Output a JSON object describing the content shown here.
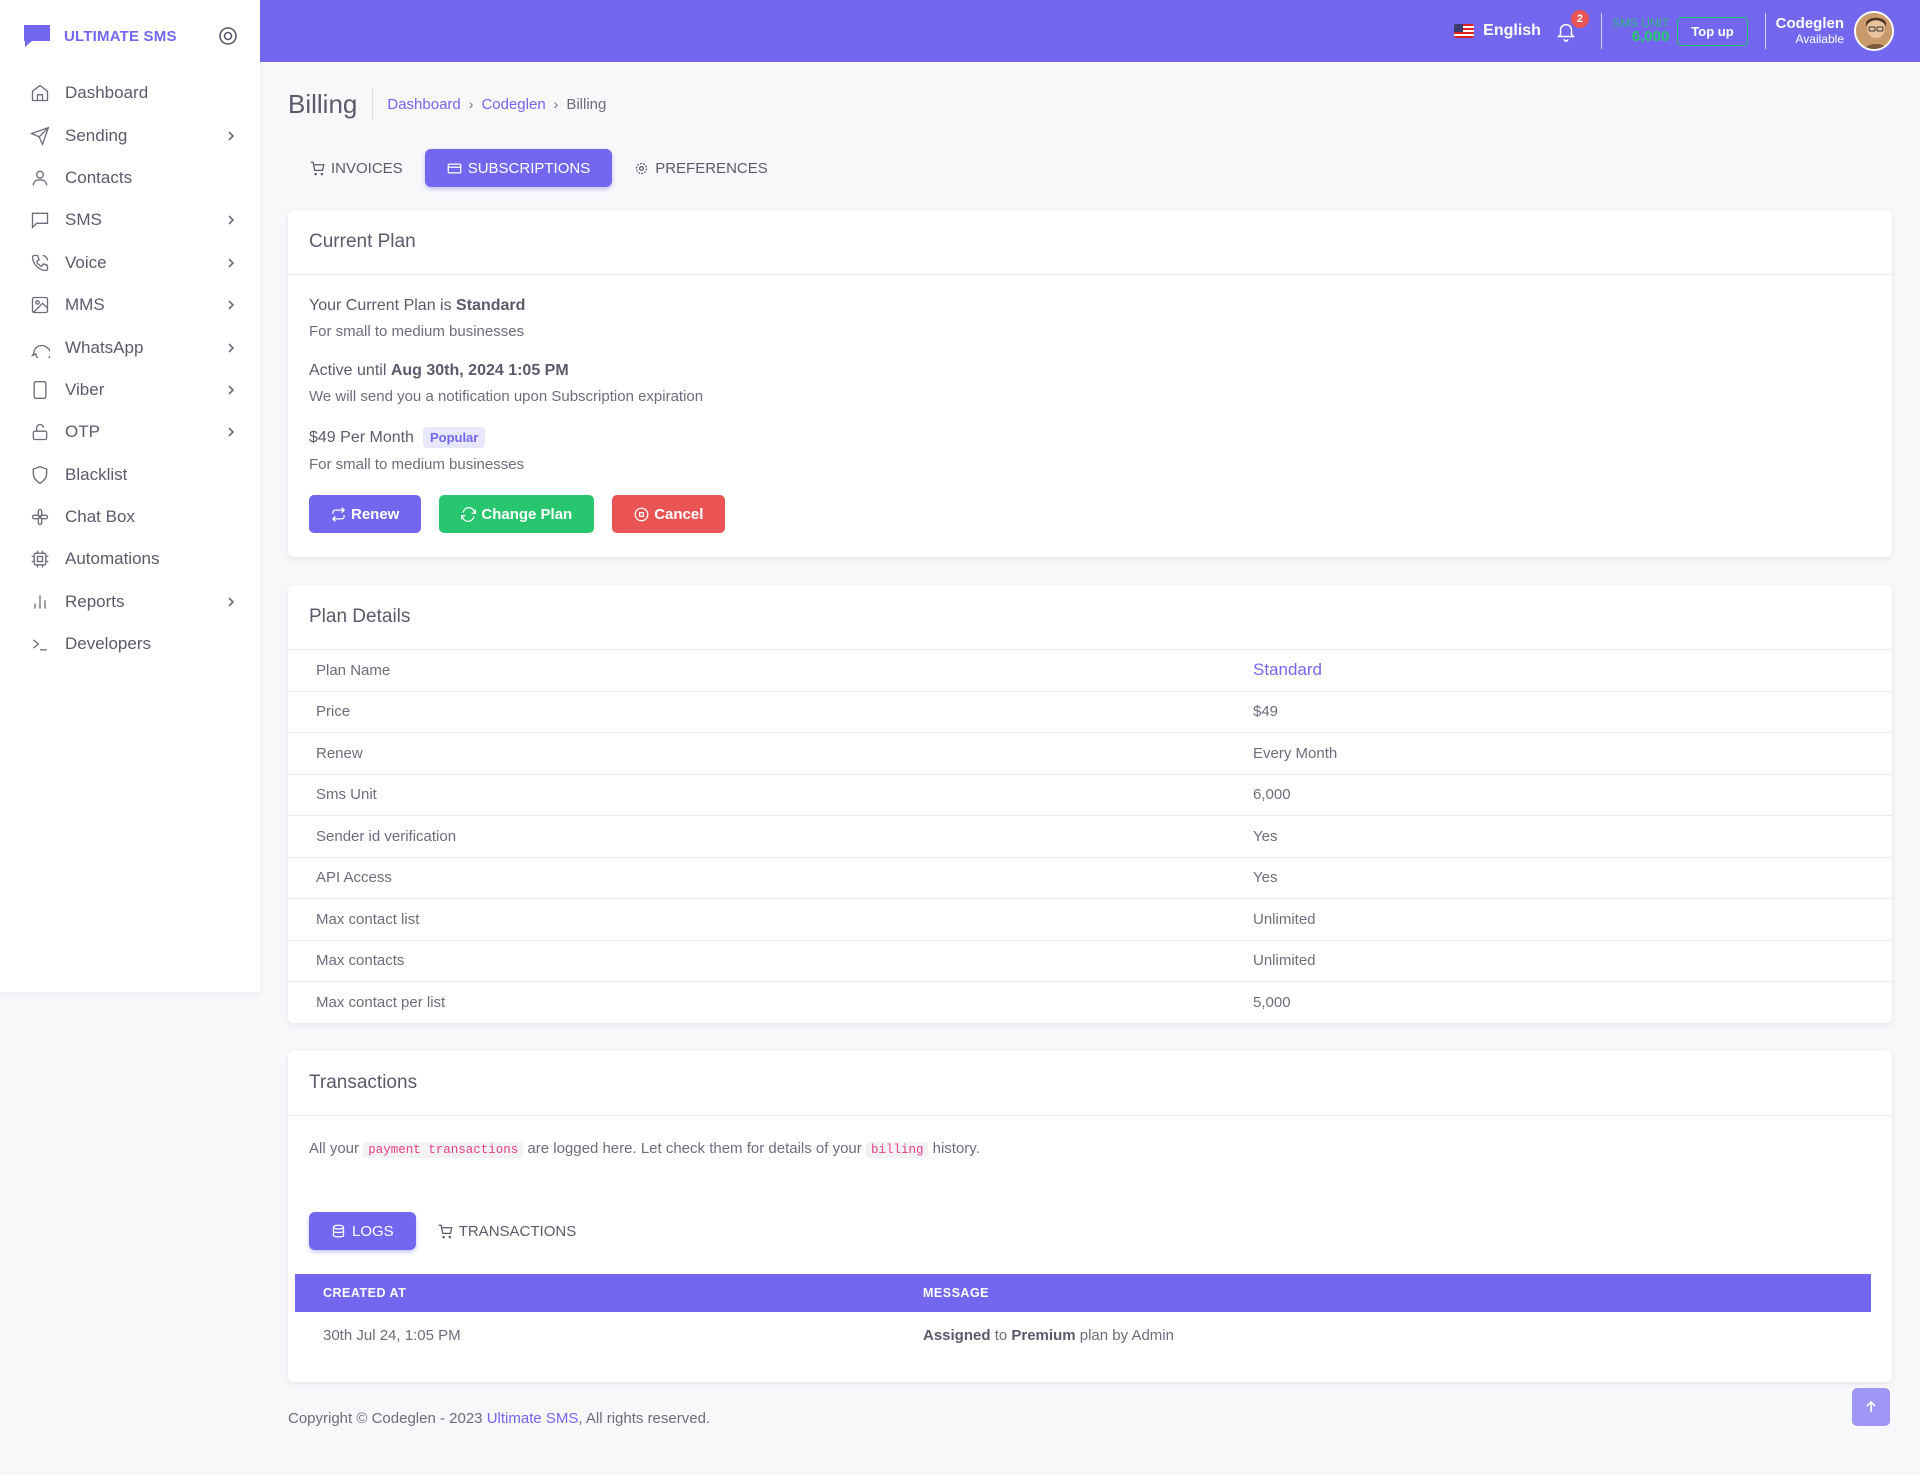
{
  "app": {
    "name": "ULTIMATE SMS"
  },
  "sidebar": {
    "items": [
      {
        "label": "Dashboard",
        "icon": "home-icon",
        "has_sub": false
      },
      {
        "label": "Sending",
        "icon": "send-icon",
        "has_sub": true
      },
      {
        "label": "Contacts",
        "icon": "user-icon",
        "has_sub": false
      },
      {
        "label": "SMS",
        "icon": "message-square-icon",
        "has_sub": true
      },
      {
        "label": "Voice",
        "icon": "phone-call-icon",
        "has_sub": true
      },
      {
        "label": "MMS",
        "icon": "image-icon",
        "has_sub": true
      },
      {
        "label": "WhatsApp",
        "icon": "message-circle-icon",
        "has_sub": true
      },
      {
        "label": "Viber",
        "icon": "tablet-icon",
        "has_sub": true
      },
      {
        "label": "OTP",
        "icon": "lock-icon",
        "has_sub": true
      },
      {
        "label": "Blacklist",
        "icon": "shield-icon",
        "has_sub": false
      },
      {
        "label": "Chat Box",
        "icon": "slack-icon",
        "has_sub": false
      },
      {
        "label": "Automations",
        "icon": "cpu-icon",
        "has_sub": false
      },
      {
        "label": "Reports",
        "icon": "bar-chart-icon",
        "has_sub": true
      },
      {
        "label": "Developers",
        "icon": "terminal-icon",
        "has_sub": false
      }
    ]
  },
  "topbar": {
    "language": "English",
    "notifications_count": "2",
    "sms_unit_label": "SMS UNIT",
    "sms_unit_value": "6,000",
    "topup_label": "Top up",
    "user_name": "Codeglen",
    "user_status": "Available"
  },
  "page": {
    "title": "Billing",
    "breadcrumbs": [
      "Dashboard",
      "Codeglen",
      "Billing"
    ]
  },
  "tabs": [
    {
      "label": "INVOICES",
      "icon": "shopping-cart-icon",
      "active": false
    },
    {
      "label": "SUBSCRIPTIONS",
      "icon": "credit-card-icon",
      "active": true
    },
    {
      "label": "PREFERENCES",
      "icon": "settings-icon",
      "active": false
    }
  ],
  "current_plan": {
    "heading": "Current Plan",
    "plan_prefix": "Your Current Plan is",
    "plan_name": "Standard",
    "plan_desc": "For small to medium businesses",
    "active_prefix": "Active until",
    "active_date": "Aug 30th, 2024 1:05 PM",
    "active_desc": "We will send you a notification upon Subscription expiration",
    "price": "$49 Per Month",
    "price_badge": "Popular",
    "price_desc": "For small to medium businesses",
    "renew_label": "Renew",
    "change_label": "Change Plan",
    "cancel_label": "Cancel"
  },
  "plan_details": {
    "heading": "Plan Details",
    "rows": [
      {
        "label": "Plan Name",
        "value": "Standard"
      },
      {
        "label": "Price",
        "value": "$49"
      },
      {
        "label": "Renew",
        "value": "Every Month"
      },
      {
        "label": "Sms Unit",
        "value": "6,000"
      },
      {
        "label": "Sender id verification",
        "value": "Yes"
      },
      {
        "label": "API Access",
        "value": "Yes"
      },
      {
        "label": "Max contact list",
        "value": "Unlimited"
      },
      {
        "label": "Max contacts",
        "value": "Unlimited"
      },
      {
        "label": "Max contact per list",
        "value": "5,000"
      }
    ]
  },
  "transactions": {
    "heading": "Transactions",
    "desc_1": "All your",
    "code_1": "payment transactions",
    "desc_2": "are logged here. Let check them for details of your",
    "code_2": "billing",
    "desc_3": "history.",
    "subtabs": [
      {
        "label": "LOGS",
        "icon": "database-icon",
        "active": true
      },
      {
        "label": "TRANSACTIONS",
        "icon": "shopping-cart-icon",
        "active": false
      }
    ],
    "columns": [
      "CREATED AT",
      "MESSAGE"
    ],
    "logs": [
      {
        "created_at": "30th Jul 24, 1:05 PM",
        "msg_1": "Assigned",
        "msg_2": "to",
        "msg_3": "Premium",
        "msg_4": "plan by Admin"
      }
    ]
  },
  "footer": {
    "text": "Copyright © Codeglen - 2023",
    "link": "Ultimate SMS",
    "suffix": ", All rights reserved."
  },
  "colors": {
    "primary": "#7367f0",
    "success": "#28c76f",
    "danger": "#ea5455"
  }
}
